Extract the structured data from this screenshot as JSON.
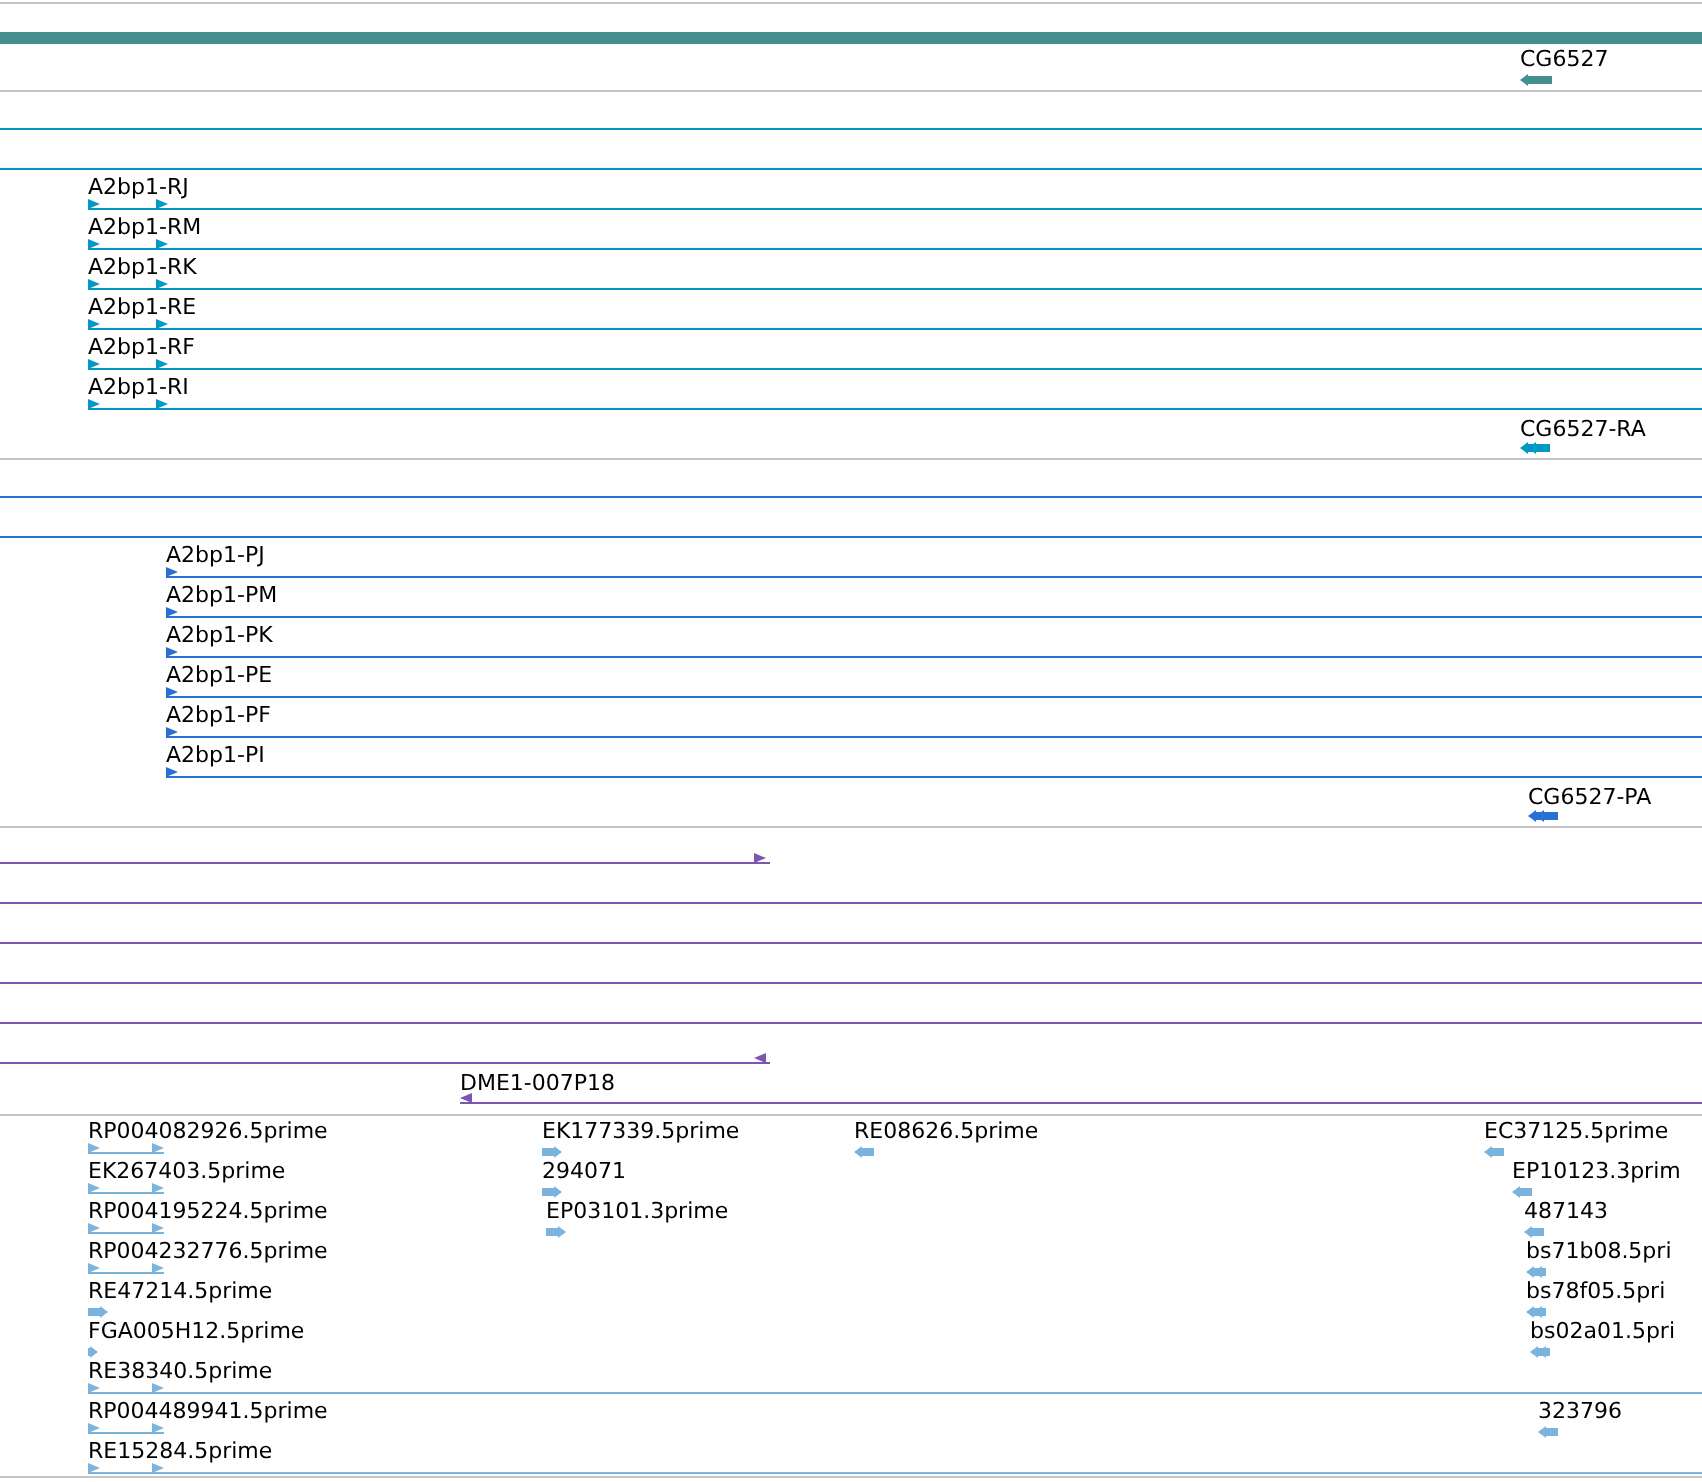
{
  "tracks": [
    {
      "kind": "gene",
      "features": [
        {
          "label": "CG6527",
          "reverse": true
        }
      ]
    },
    {
      "kind": "transcript",
      "features": [
        {
          "label": "A2bp1-RJ",
          "reverse": false
        },
        {
          "label": "A2bp1-RM",
          "reverse": false
        },
        {
          "label": "A2bp1-RK",
          "reverse": false
        },
        {
          "label": "A2bp1-RE",
          "reverse": false
        },
        {
          "label": "A2bp1-RF",
          "reverse": false
        },
        {
          "label": "A2bp1-RI",
          "reverse": false
        },
        {
          "label": "CG6527-RA",
          "reverse": true
        }
      ]
    },
    {
      "kind": "protein",
      "features": [
        {
          "label": "A2bp1-PJ",
          "reverse": false
        },
        {
          "label": "A2bp1-PM",
          "reverse": false
        },
        {
          "label": "A2bp1-PK",
          "reverse": false
        },
        {
          "label": "A2bp1-PE",
          "reverse": false
        },
        {
          "label": "A2bp1-PF",
          "reverse": false
        },
        {
          "label": "A2bp1-PI",
          "reverse": false
        },
        {
          "label": "CG6527-PA",
          "reverse": true
        }
      ]
    },
    {
      "kind": "clone",
      "features": [
        {
          "label": "DME1-007P18",
          "reverse": true
        }
      ]
    },
    {
      "kind": "est",
      "features": [
        {
          "label": "RP004082926.5prime",
          "reverse": false
        },
        {
          "label": "EK177339.5prime",
          "reverse": false
        },
        {
          "label": "RE08626.5prime",
          "reverse": true
        },
        {
          "label": "EC37125.5prime",
          "reverse": true
        },
        {
          "label": "EK267403.5prime",
          "reverse": false
        },
        {
          "label": "294071",
          "reverse": false
        },
        {
          "label": "EP10123.3prim",
          "reverse": true
        },
        {
          "label": "RP004195224.5prime",
          "reverse": false
        },
        {
          "label": "EP03101.3prime",
          "reverse": false
        },
        {
          "label": "487143",
          "reverse": true
        },
        {
          "label": "RP004232776.5prime",
          "reverse": false
        },
        {
          "label": "bs71b08.5pri",
          "reverse": true
        },
        {
          "label": "RE47214.5prime",
          "reverse": false
        },
        {
          "label": "bs78f05.5pri",
          "reverse": true
        },
        {
          "label": "FGA005H12.5prime",
          "reverse": false
        },
        {
          "label": "bs02a01.5pri",
          "reverse": true
        },
        {
          "label": "RE38340.5prime",
          "reverse": false
        },
        {
          "label": "RP004489941.5prime",
          "reverse": false
        },
        {
          "label": "323796",
          "reverse": true
        },
        {
          "label": "RE15284.5prime",
          "reverse": false
        }
      ]
    }
  ]
}
